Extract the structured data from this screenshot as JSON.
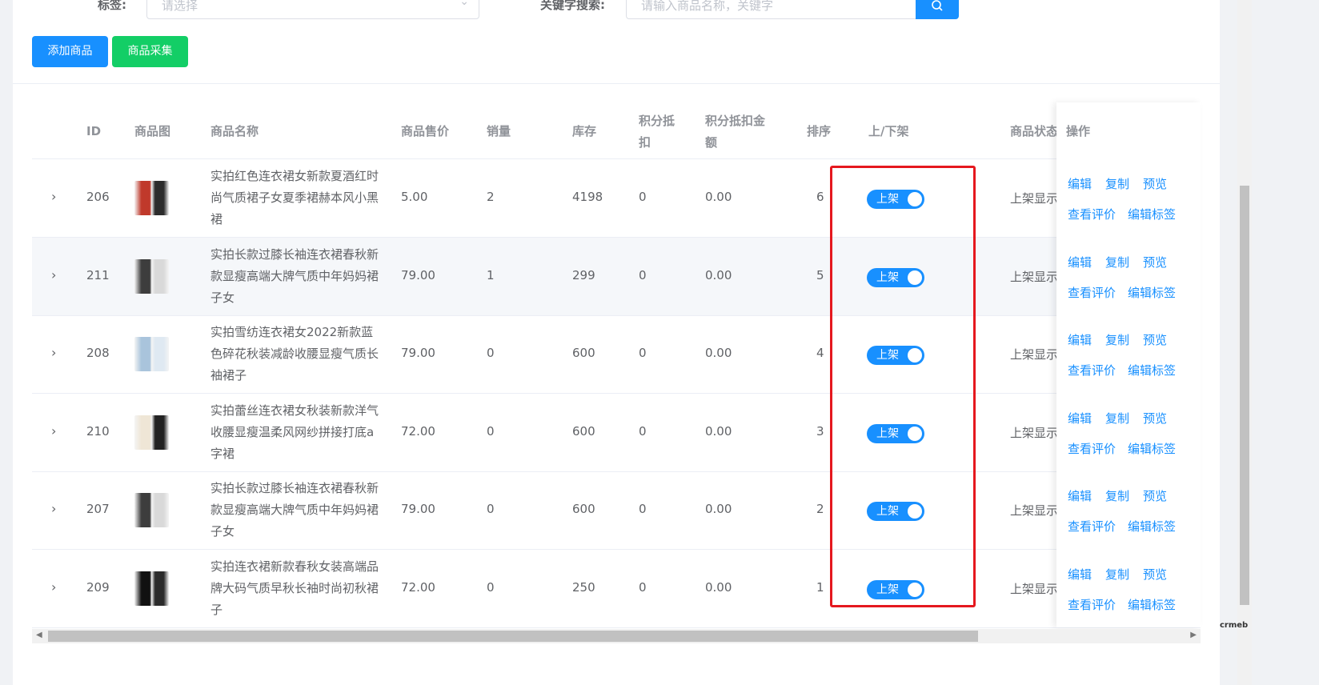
{
  "filters": {
    "tag_label": "标签:",
    "tag_placeholder": "请选择",
    "keyword_label": "关键字搜索:",
    "keyword_placeholder": "请输入商品名称，关键字"
  },
  "toolbar": {
    "add_label": "添加商品",
    "collect_label": "商品采集"
  },
  "table": {
    "headers": {
      "id": "ID",
      "image": "商品图",
      "name": "商品名称",
      "price": "商品售价",
      "sales": "销量",
      "stock": "库存",
      "points_deduct_1": "积分抵",
      "points_deduct_2": "扣",
      "points_amount_1": "积分抵扣金",
      "points_amount_2": "额",
      "sort": "排序",
      "shelf": "上/下架",
      "status": "商品状态",
      "ops": "操作"
    },
    "rows": [
      {
        "id": "206",
        "name": "实拍红色连衣裙女新款夏酒红时尚气质裙子女夏季裙赫本风小黑裙",
        "price": "5.00",
        "sales": "2",
        "stock": "4198",
        "points": "0",
        "points_amount": "0.00",
        "sort": "6",
        "shelf": "上架",
        "status": "上架显示"
      },
      {
        "id": "211",
        "name": "实拍长款过膝长袖连衣裙春秋新款显瘦高端大牌气质中年妈妈裙子女",
        "price": "79.00",
        "sales": "1",
        "stock": "299",
        "points": "0",
        "points_amount": "0.00",
        "sort": "5",
        "shelf": "上架",
        "status": "上架显示"
      },
      {
        "id": "208",
        "name": "实拍雪纺连衣裙女2022新款蓝色碎花秋装减龄收腰显瘦气质长袖裙子",
        "price": "79.00",
        "sales": "0",
        "stock": "600",
        "points": "0",
        "points_amount": "0.00",
        "sort": "4",
        "shelf": "上架",
        "status": "上架显示"
      },
      {
        "id": "210",
        "name": "实拍蕾丝连衣裙女秋装新款洋气收腰显瘦温柔风网纱拼接打底a字裙",
        "price": "72.00",
        "sales": "0",
        "stock": "600",
        "points": "0",
        "points_amount": "0.00",
        "sort": "3",
        "shelf": "上架",
        "status": "上架显示"
      },
      {
        "id": "207",
        "name": "实拍长款过膝长袖连衣裙春秋新款显瘦高端大牌气质中年妈妈裙子女",
        "price": "79.00",
        "sales": "0",
        "stock": "600",
        "points": "0",
        "points_amount": "0.00",
        "sort": "2",
        "shelf": "上架",
        "status": "上架显示"
      },
      {
        "id": "209",
        "name": "实拍连衣裙新款春秋女装高端品牌大码气质早秋长袖时尚初秋裙子",
        "price": "72.00",
        "sales": "0",
        "stock": "250",
        "points": "0",
        "points_amount": "0.00",
        "sort": "1",
        "shelf": "上架",
        "status": "上架显示"
      }
    ],
    "ops_labels": {
      "edit": "编辑",
      "copy": "复制",
      "preview": "预览",
      "reviews": "查看评价",
      "edit_tags": "编辑标签"
    }
  },
  "watermark": "crmeb",
  "colors": {
    "primary": "#1890ff",
    "success": "#13ce66",
    "highlight": "#e5181e"
  }
}
